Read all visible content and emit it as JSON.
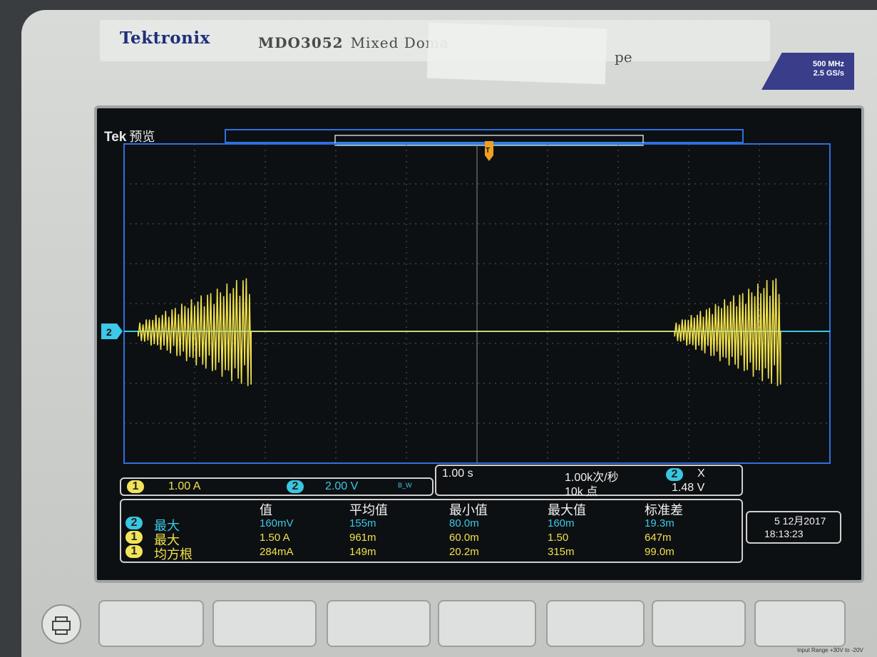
{
  "device": {
    "brand": "Tektronix",
    "model": "MDO3052",
    "model_desc": "Mixed Doma",
    "model_desc_tail": "pe",
    "spec_bandwidth": "500 MHz",
    "spec_samplerate": "2.5 GS/s",
    "input_range": "Input Range +30V to -20V"
  },
  "screen": {
    "tek_label": "Tek",
    "mode_label": "预览"
  },
  "waveform": {
    "ch2_marker": "2",
    "trigger_marker": "T",
    "burst_left_start_div": 0.2,
    "burst_left_end_div": 1.8,
    "burst_right_start_div": 7.8,
    "burst_right_end_div": 9.3
  },
  "channels": {
    "ch1_num": "1",
    "ch1_scale": "1.00 A",
    "ch2_num": "2",
    "ch2_scale": "2.00 V",
    "bw_icon": "B_W"
  },
  "timebase": {
    "time_div": "1.00 s",
    "rate": "1.00k次/秒",
    "points": "10k 点",
    "trig_ch": "2",
    "trig_sym": "X",
    "trig_level": "1.48 V"
  },
  "measurements": {
    "headers": [
      "值",
      "平均值",
      "最小值",
      "最大值",
      "标准差"
    ],
    "rows": [
      {
        "ch": "2",
        "name": "最大",
        "color": "#3cc8e6",
        "values": [
          "160mV",
          "155m",
          "80.0m",
          "160m",
          "19.3m"
        ]
      },
      {
        "ch": "1",
        "name": "最大",
        "color": "#f0e04c",
        "values": [
          "1.50 A",
          "961m",
          "60.0m",
          "1.50",
          "647m"
        ]
      },
      {
        "ch": "1",
        "name": "均方根",
        "color": "#f0e04c",
        "values": [
          "284mA",
          "149m",
          "20.2m",
          "315m",
          "99.0m"
        ]
      }
    ]
  },
  "datetime": {
    "date": "5 12月2017",
    "time": "18:13:23"
  }
}
